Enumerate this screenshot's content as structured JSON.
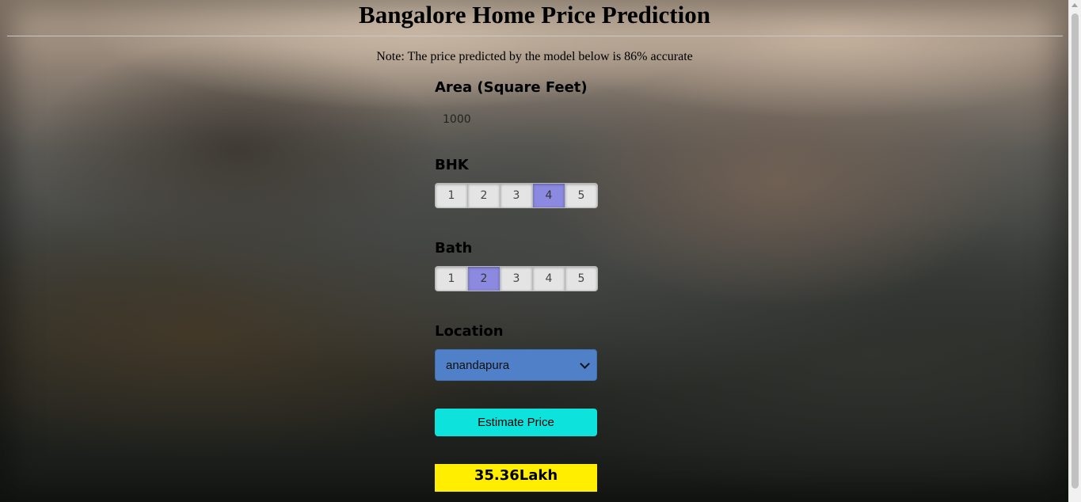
{
  "header": {
    "title": "Bangalore Home Price Prediction",
    "note": "Note: The price predicted by the model below is 86% accurate"
  },
  "form": {
    "area": {
      "label": "Area (Square Feet)",
      "value": "1000"
    },
    "bhk": {
      "label": "BHK",
      "options": [
        "1",
        "2",
        "3",
        "4",
        "5"
      ],
      "selected": "4"
    },
    "bath": {
      "label": "Bath",
      "options": [
        "1",
        "2",
        "3",
        "4",
        "5"
      ],
      "selected": "2"
    },
    "location": {
      "label": "Location",
      "selected": "anandapura"
    },
    "estimate_button": "Estimate Price",
    "result": "35.36Lakh"
  },
  "colors": {
    "selected_option": "#8b89e0",
    "location_select": "#4f80c8",
    "estimate_button": "#0de2dc",
    "result_background": "#ffee00"
  }
}
